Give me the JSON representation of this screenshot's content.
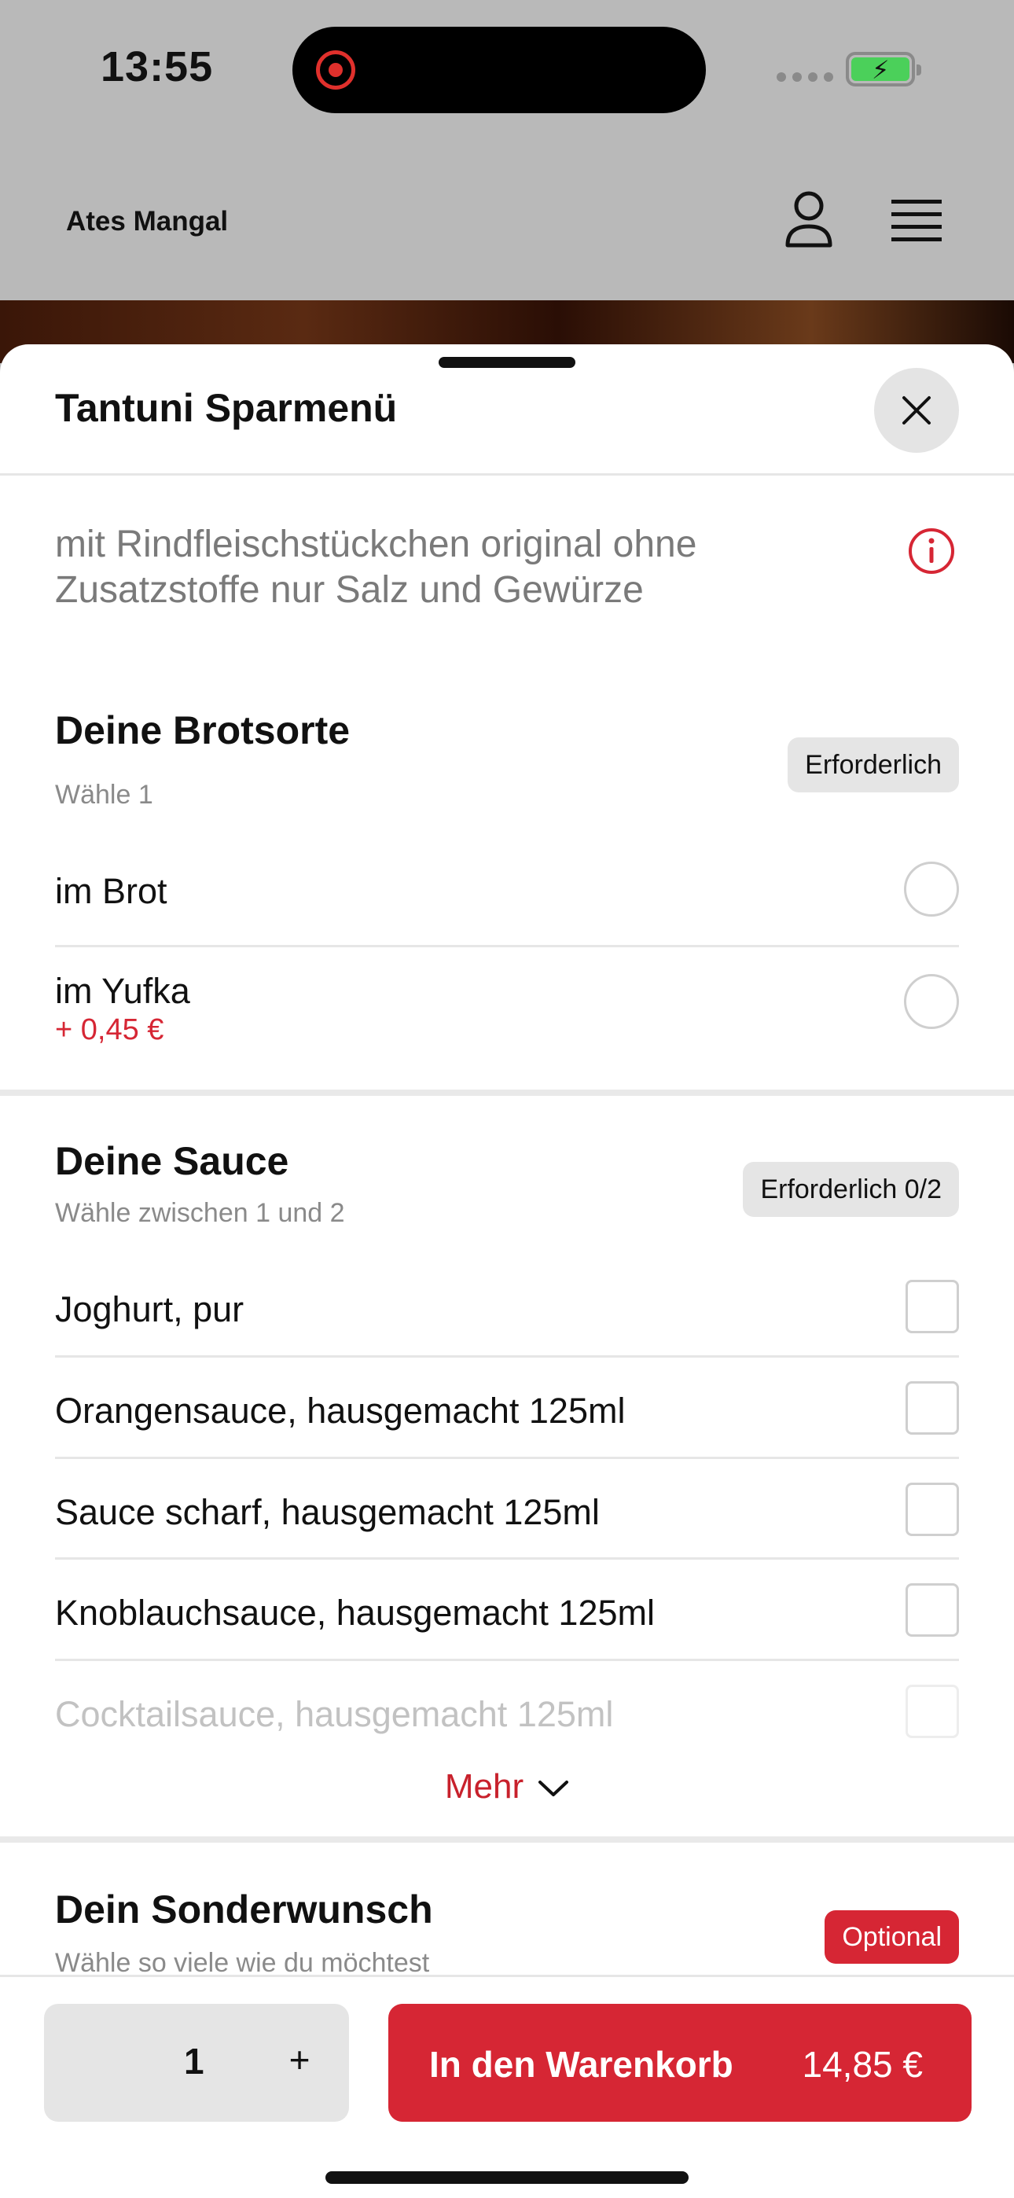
{
  "status_bar": {
    "time": "13:55"
  },
  "header": {
    "brand": "Ates Mangal",
    "user_icon": "user-icon",
    "menu_icon": "hamburger-menu-icon"
  },
  "sheet": {
    "title": "Tantuni Sparmenü",
    "description": "mit Rindfleischstückchen original ohne Zusatzstoffe nur Salz und Gewürze",
    "sections": [
      {
        "title": "Deine Brotsorte",
        "subtitle": "Wähle 1",
        "badge": "Erforderlich",
        "options": [
          {
            "label": "im Brot",
            "price": ""
          },
          {
            "label": "im Yufka",
            "price": "+ 0,45 €"
          }
        ]
      },
      {
        "title": "Deine Sauce",
        "subtitle": "Wähle zwischen 1 und 2",
        "badge": "Erforderlich 0/2",
        "options": [
          {
            "label": "Joghurt, pur"
          },
          {
            "label": "Orangensauce, hausgemacht 125ml"
          },
          {
            "label": "Sauce scharf, hausgemacht 125ml"
          },
          {
            "label": "Knoblauchsauce, hausgemacht 125ml"
          },
          {
            "label": "Cocktailsauce, hausgemacht 125ml"
          }
        ],
        "more_label": "Mehr"
      },
      {
        "title": "Dein Sonderwunsch",
        "subtitle": "Wähle so viele wie du möchtest",
        "badge": "Optional"
      }
    ]
  },
  "footer": {
    "quantity": "1",
    "plus_label": "+",
    "add_to_cart_label": "In den Warenkorb",
    "total_price": "14,85 €"
  },
  "colors": {
    "accent": "#d62634",
    "badge_bg": "#e5e5e5",
    "divider": "#e6e6e6"
  }
}
